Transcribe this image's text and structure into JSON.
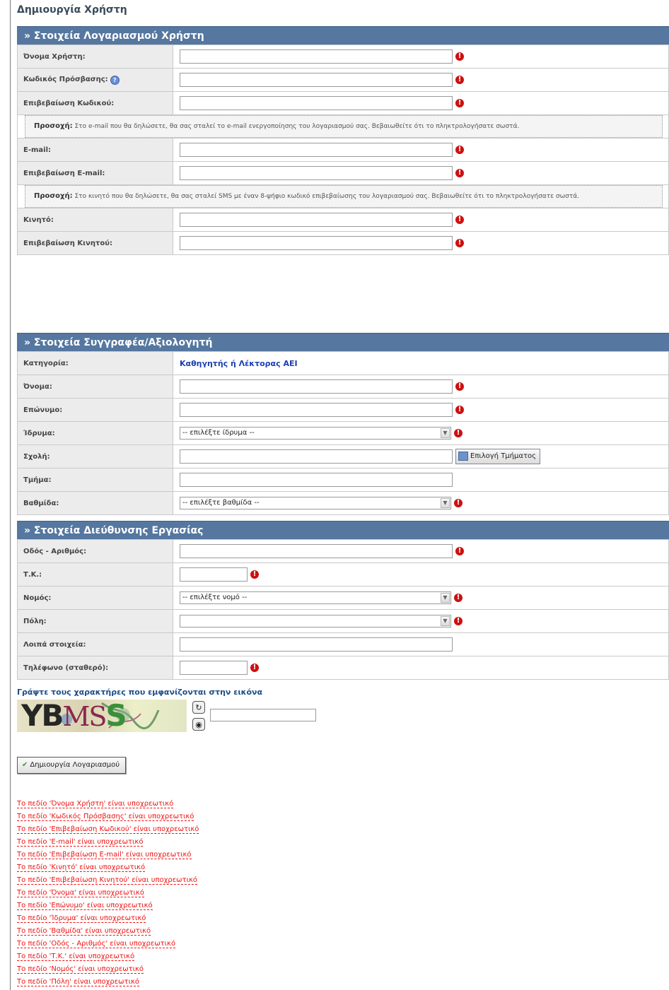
{
  "page": {
    "title": "Δημιουργία Χρήστη"
  },
  "account": {
    "header": "» Στοιχεία Λογαριασμού Χρήστη",
    "username_label": "Όνομα Χρήστη:",
    "password_label": "Κωδικός Πρόσβασης:",
    "password_confirm_label": "Επιβεβαίωση Κωδικού:",
    "email_notice_strong": "Προσοχή:",
    "email_notice_text": " Στο e-mail που θα δηλώσετε, θα σας σταλεί το e-mail ενεργοποίησης του λογαριασμού σας. Βεβαιωθείτε ότι το πληκτρολογήσατε σωστά.",
    "email_label": "E-mail:",
    "email_confirm_label": "Επιβεβαίωση E-mail:",
    "mobile_notice_strong": "Προσοχή:",
    "mobile_notice_text": " Στο κινητό που θα δηλώσετε, θα σας σταλεί SMS με έναν 8-ψήφιο κωδικό επιβεβαίωσης του λογαριασμού σας. Βεβαιωθείτε ότι το πληκτρολογήσατε σωστά.",
    "mobile_label": "Κινητό:",
    "mobile_confirm_label": "Επιβεβαίωση Κινητού:"
  },
  "author": {
    "header": "» Στοιχεία Συγγραφέα/Αξιολογητή",
    "category_label": "Κατηγορία:",
    "category_value": "Καθηγητής ή Λέκτορας ΑΕΙ",
    "first_name_label": "Όνομα:",
    "last_name_label": "Επώνυμο:",
    "institution_label": "Ίδρυμα:",
    "institution_select": "-- επιλέξτε ίδρυμα --",
    "school_label": "Σχολή:",
    "select_department_button": "Επιλογή Τμήματος",
    "department_label": "Τμήμα:",
    "rank_label": "Βαθμίδα:",
    "rank_select": "-- επιλέξτε βαθμίδα --"
  },
  "address": {
    "header": "» Στοιχεία Διεύθυνσης Εργασίας",
    "street_label": "Οδός - Αριθμός:",
    "postcode_label": "Τ.Κ.:",
    "prefecture_label": "Νομός:",
    "prefecture_select": "-- επιλέξτε νομό --",
    "city_label": "Πόλη:",
    "city_select": "",
    "other_label": "Λοιπά στοιχεία:",
    "phone_label": "Τηλέφωνο (σταθερό):"
  },
  "captcha": {
    "title": "Γράψτε τους χαρακτήρες που εμφανίζονται στην εικόνα",
    "part1": "YB",
    "part2": "MS",
    "part3": "S"
  },
  "submit_label": "Δημιουργία Λογαριασμού",
  "errors": [
    "Το πεδίο 'Όνομα Χρήστη' είναι υποχρεωτικό",
    "Το πεδίο 'Κωδικός Πρόσβασης' είναι υποχρεωτικό",
    "Το πεδίο 'Επιβεβαίωση Κωδικού' είναι υποχρεωτικό",
    "Το πεδίο 'E-mail' είναι υποχρεωτικό",
    "Το πεδίο 'Επιβεβαίωση E-mail' είναι υποχρεωτικό",
    "Το πεδίο 'Κινητό' είναι υποχρεωτικό",
    "Το πεδίο 'Επιβεβαίωση Κινητού' είναι υποχρεωτικό",
    "Το πεδίο 'Όνομα' είναι υποχρεωτικό",
    "Το πεδίο 'Επώνυμο' είναι υποχρεωτικό",
    "Το πεδίο 'Ίδρυμα' είναι υποχρεωτικό",
    "Το πεδίο 'Βαθμίδα' είναι υποχρεωτικό",
    "Το πεδίο 'Οδός - Αριθμός' είναι υποχρεωτικό",
    "Το πεδίο 'Τ.Κ.' είναι υποχρεωτικό",
    "Το πεδίο 'Νομός' είναι υποχρεωτικό",
    "Το πεδίο 'Πόλη' είναι υποχρεωτικό"
  ]
}
